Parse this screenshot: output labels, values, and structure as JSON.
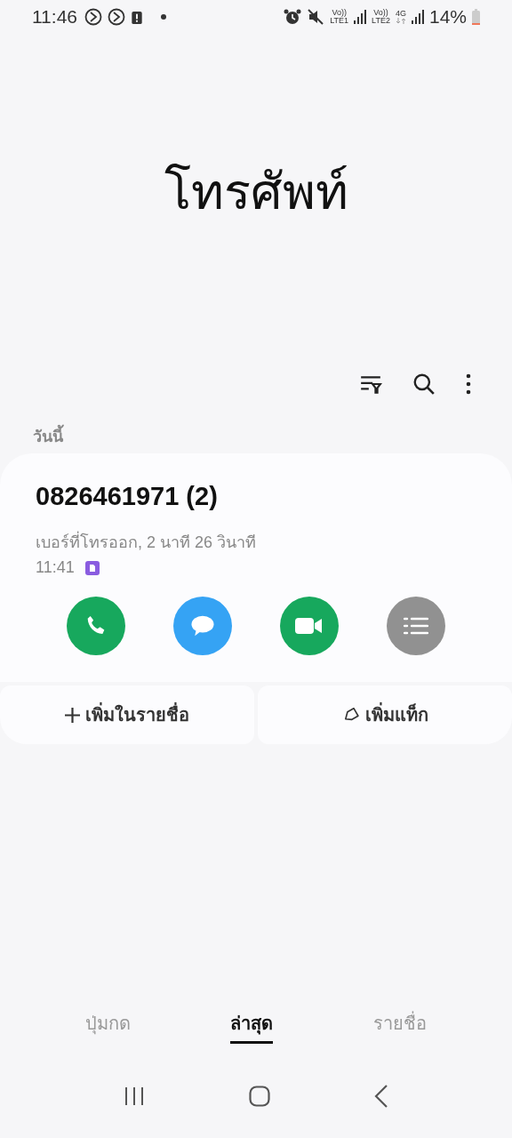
{
  "status_bar": {
    "time": "11:46",
    "sim1": {
      "volte": "Vo))",
      "label": "LTE1"
    },
    "sim2": {
      "volte": "Vo))",
      "label": "LTE2",
      "network": "4G"
    },
    "battery": "14%"
  },
  "title": "โทรศัพท์",
  "section": "วันนี้",
  "call": {
    "number": "0826461971 (2)",
    "detail": "เบอร์ที่โทรออก, 2 นาที 26 วินาที",
    "time": "11:41",
    "actions": [
      {
        "kind": "call",
        "color": "#17a85d"
      },
      {
        "kind": "message",
        "color": "#35a3f4"
      },
      {
        "kind": "video",
        "color": "#17a85d"
      },
      {
        "kind": "details",
        "color": "#919191"
      }
    ]
  },
  "buttons": [
    {
      "kind": "add",
      "label": "เพิ่มในรายชื่อ"
    },
    {
      "kind": "tag",
      "label": "เพิ่มแท็ก"
    }
  ],
  "tabs": [
    {
      "label": "ปุ่มกด",
      "selected": false
    },
    {
      "label": "ล่าสุด",
      "selected": true
    },
    {
      "label": "รายชื่อ",
      "selected": false
    }
  ]
}
